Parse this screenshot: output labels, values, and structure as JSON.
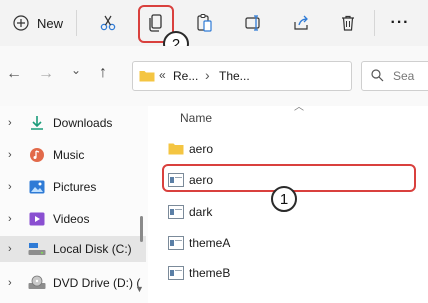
{
  "toolbar": {
    "new_label": "New",
    "more_glyph": "···"
  },
  "address": {
    "chevrons": "«",
    "segment1": "Re...",
    "separator": "›",
    "segment2": "The..."
  },
  "search": {
    "placeholder": "Sea"
  },
  "nav": {
    "back": "←",
    "forward": "→",
    "up": "↑",
    "dropdown": "⌄",
    "refresh": "↻"
  },
  "sidebar": {
    "items": [
      {
        "label": "Downloads",
        "icon": "download-icon"
      },
      {
        "label": "Music",
        "icon": "music-icon"
      },
      {
        "label": "Pictures",
        "icon": "pictures-icon"
      },
      {
        "label": "Videos",
        "icon": "videos-icon"
      },
      {
        "label": "Local Disk (C:)",
        "icon": "drive-icon"
      },
      {
        "label": "DVD Drive (D:) (",
        "icon": "dvd-icon"
      }
    ]
  },
  "list": {
    "column_header": "Name",
    "rows": [
      {
        "name": "aero",
        "icon": "folder-icon"
      },
      {
        "name": "aero",
        "icon": "theme-file-icon"
      },
      {
        "name": "dark",
        "icon": "theme-file-icon"
      },
      {
        "name": "themeA",
        "icon": "theme-file-icon"
      },
      {
        "name": "themeB",
        "icon": "theme-file-icon"
      }
    ]
  },
  "annotations": {
    "step1": "1",
    "step2": "2"
  },
  "colors": {
    "annotation_red": "#d9403d",
    "folder_yellow": "#f4c542",
    "accent_blue": "#2f7bd6"
  }
}
